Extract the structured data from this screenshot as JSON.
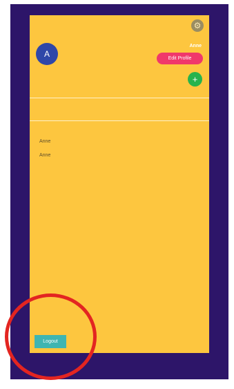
{
  "header": {
    "avatar_initial": "A",
    "username": "Anne",
    "edit_profile_label": "Edit Profile",
    "add_icon": "plus-icon",
    "settings_icon": "gear-icon"
  },
  "list": {
    "items": [
      {
        "label": "Anne"
      },
      {
        "label": "Anne"
      }
    ]
  },
  "footer": {
    "logout_label": "Logout"
  },
  "colors": {
    "frame": "#2d1569",
    "screen": "#fdc63f",
    "edit_button": "#f0386b",
    "add_button": "#27b34d",
    "avatar": "#2f47a8",
    "logout_button": "#3fb5b1",
    "highlight_circle": "#e32521"
  }
}
